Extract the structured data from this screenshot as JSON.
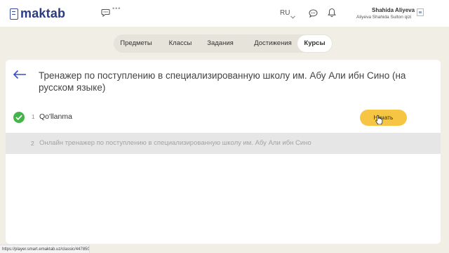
{
  "header": {
    "logo_text": "maktab",
    "typing_indicator": "•••",
    "language": "RU",
    "user_name": "Shahida Aliyeva",
    "user_full_name": "Aliyeva Shahida Sulton qizi"
  },
  "tabs": [
    {
      "label": "Предметы",
      "active": false
    },
    {
      "label": "Классы",
      "active": false
    },
    {
      "label": "Задания",
      "active": false
    },
    {
      "label": "Достижения",
      "active": false
    },
    {
      "label": "Курсы",
      "active": true
    }
  ],
  "course": {
    "title": "Тренажер по поступлению в специализированную школу им. Абу Али ибн Сино (на русском языке)",
    "lessons": [
      {
        "number": "1",
        "title": "Qo'llanma",
        "completed": true,
        "action_label": "Начать"
      },
      {
        "number": "2",
        "title": "Онлайн тренажер по поступлению в специализированную школу им. Абу Али ибн Сино",
        "completed": false
      }
    ]
  },
  "status_url": "https://player.smart.emaktab.uz/classic/447850",
  "colors": {
    "brand": "#2b3a85",
    "accent_button": "#f7c544",
    "check_green": "#43b34a",
    "back_arrow": "#3b4fc4"
  }
}
